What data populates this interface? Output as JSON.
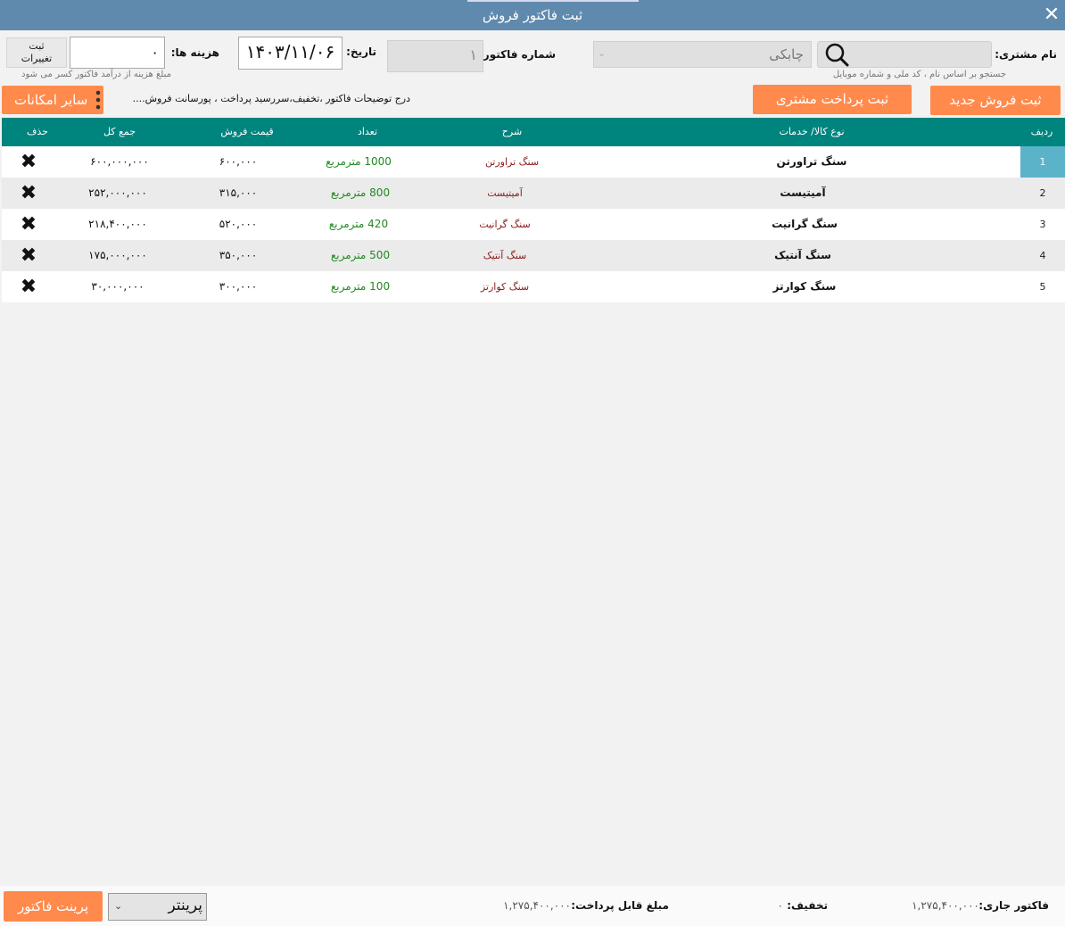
{
  "window": {
    "title": "ثبت فاکتور فروش",
    "close_icon": "close-icon"
  },
  "header": {
    "customer_label": "نام مشتری:",
    "customer_search_hint": "جستجو بر اساس نام ، کد ملی و شماره موبایل",
    "customer_combo_value": "چابکی",
    "invoice_number_label": "شماره فاکتور:",
    "invoice_number_value": "۱",
    "date_label": "تاریخ:",
    "date_value": "۱۴۰۳/۱۱/۰۶",
    "expenses_label": "هزینه ها:",
    "expenses_value": "۰",
    "expenses_hint": "مبلغ هزینه از درآمد فاکتور کسر می شود",
    "save_changes_label": "ثبت تغییرات"
  },
  "actions": {
    "new_sale": "ثبت فروش جدید",
    "customer_payment": "ثبت پرداخت مشتری",
    "invoice_notes_hint": "درج توضیحات فاکتور ،تخفیف،سررسید پرداخت ، پورسانت فروش....",
    "more_options": "سایر امکانات"
  },
  "table": {
    "columns": {
      "index": "ردیف",
      "product": "نوع کالا/ خدمات",
      "description": "شرح",
      "quantity": "تعداد",
      "price": "قیمت فروش",
      "total": "جمع کل",
      "delete": "حذف"
    },
    "rows": [
      {
        "index": "1",
        "product": "سنگ تراورتن",
        "description": "سنگ تراورتن",
        "quantity": "1000 مترمربع",
        "price": "۶۰۰,۰۰۰",
        "total": "۶۰۰,۰۰۰,۰۰۰"
      },
      {
        "index": "2",
        "product": "آمیتیست",
        "description": "آمیتیست",
        "quantity": "800 مترمربع",
        "price": "۳۱۵,۰۰۰",
        "total": "۲۵۲,۰۰۰,۰۰۰"
      },
      {
        "index": "3",
        "product": "سنگ گرانیت",
        "description": "سنگ گرانیت",
        "quantity": "420 مترمربع",
        "price": "۵۲۰,۰۰۰",
        "total": "۲۱۸,۴۰۰,۰۰۰"
      },
      {
        "index": "4",
        "product": "سنگ آنتیک",
        "description": "سنگ آنتیک",
        "quantity": "500 مترمربع",
        "price": "۳۵۰,۰۰۰",
        "total": "۱۷۵,۰۰۰,۰۰۰"
      },
      {
        "index": "5",
        "product": "سنگ کوارتز",
        "description": "سنگ کوارتز",
        "quantity": "100 مترمربع",
        "price": "۳۰۰,۰۰۰",
        "total": "۳۰,۰۰۰,۰۰۰"
      }
    ],
    "delete_glyph": "✖"
  },
  "footer": {
    "current_invoice_label": "فاکتور جاری:",
    "current_invoice_value": "۱,۲۷۵,۴۰۰,۰۰۰",
    "discount_label": "تخفیف:",
    "discount_value": "۰",
    "payable_label": "مبلغ قابل پرداخت:",
    "payable_value": "۱,۲۷۵,۴۰۰,۰۰۰",
    "printer_select_value": "پرینتر",
    "print_button": "پرینت فاکتور"
  },
  "colors": {
    "titlebar": "#5f8aad",
    "accent": "#ff8a4c",
    "table_header": "#00847e",
    "selected_index": "#5bb3c9"
  }
}
